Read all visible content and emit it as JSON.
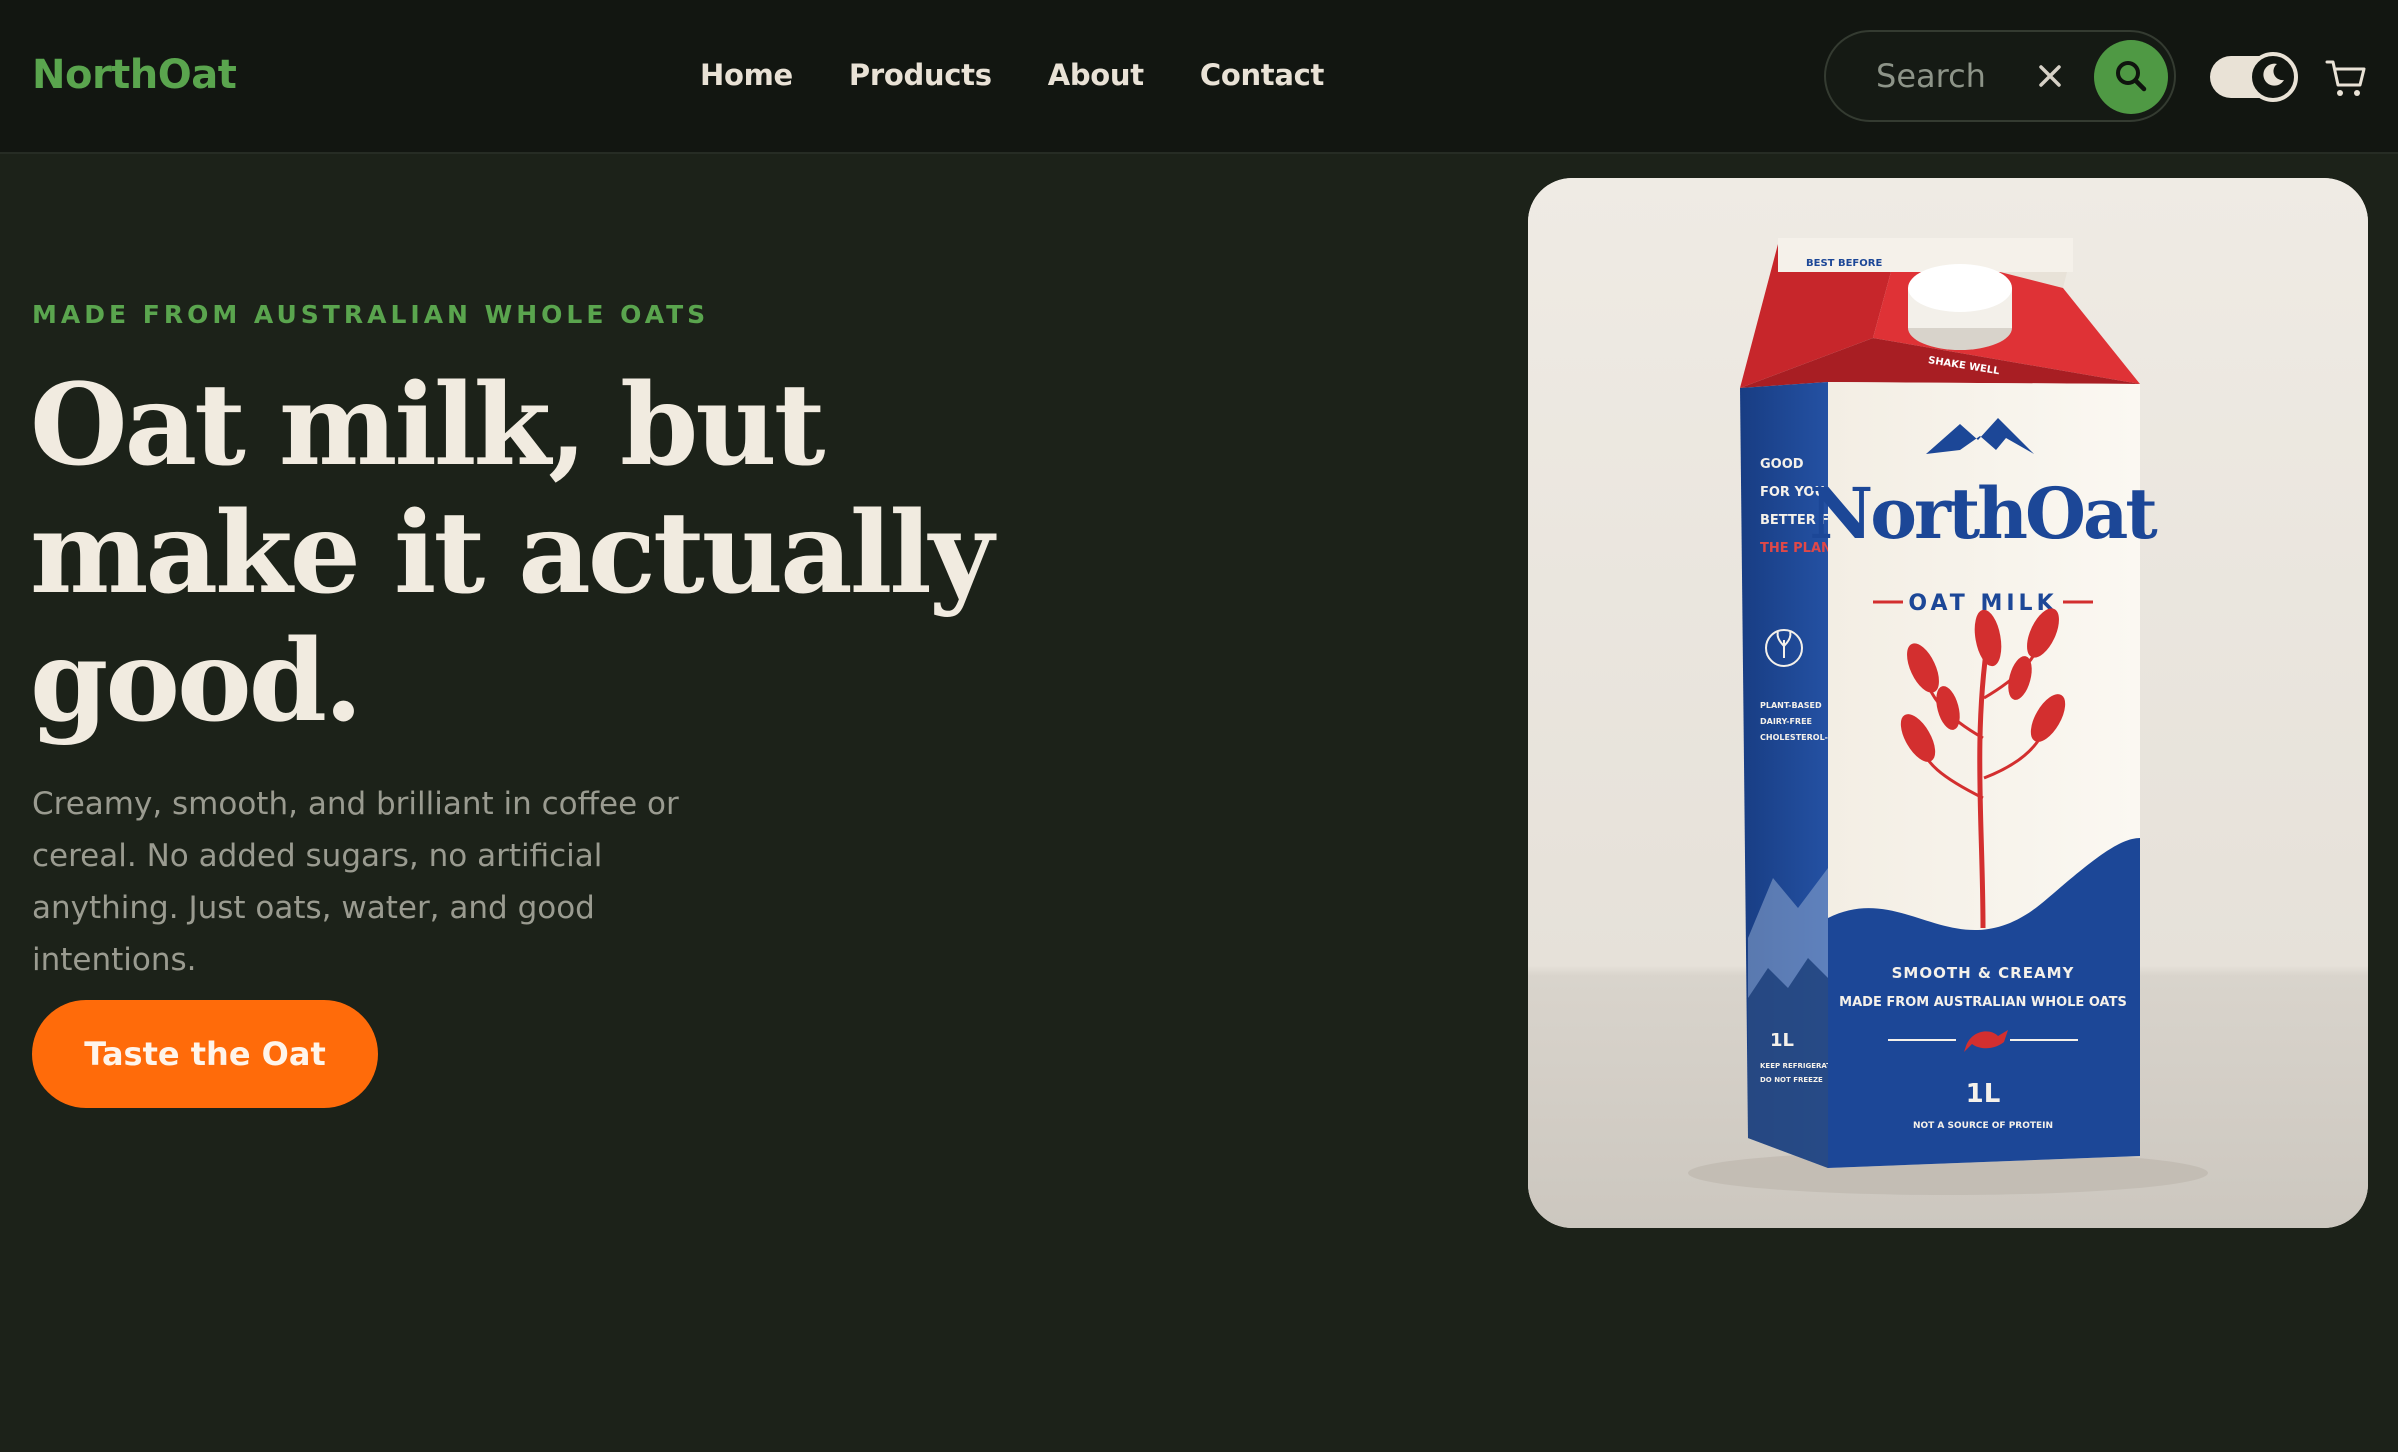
{
  "header": {
    "logo": "NorthOat",
    "nav": [
      "Home",
      "Products",
      "About",
      "Contact"
    ],
    "search": {
      "placeholder": "Search",
      "value": ""
    }
  },
  "hero": {
    "eyebrow": "MADE FROM AUSTRALIAN WHOLE OATS",
    "headline": "Oat milk, but make it actually good.",
    "subcopy": "Creamy, smooth, and brilliant in coffee or cereal. No added sugars, no artificial anything. Just oats, water, and good intentions.",
    "cta": "Taste the Oat"
  },
  "carton": {
    "top_label": "BEST BEFORE",
    "cap_label": "SHAKE WELL",
    "brand": "NorthOat",
    "product": "OAT MILK",
    "side_lines": [
      "GOOD",
      "FOR YOU.",
      "BETTER FOR",
      "THE PLANET."
    ],
    "side_claims": [
      "PLANT-BASED",
      "DAIRY-FREE",
      "CHOLESTEROL-FREE"
    ],
    "tagline": "SMOOTH & CREAMY",
    "origin": "MADE FROM AUSTRALIAN WHOLE OATS",
    "volume": "1L",
    "side_volume": "1L",
    "side_storage": [
      "KEEP REFRIGERATED",
      "DO NOT FREEZE"
    ],
    "footnote": "NOT A SOURCE OF PROTEIN"
  },
  "colors": {
    "background": "#1c2219",
    "header": "#121611",
    "accent_green": "#5aa54e",
    "cta_orange": "#ff6b0a",
    "carton_red": "#d32f2f",
    "carton_blue": "#1c4797"
  },
  "icons": [
    "clear-icon",
    "search-icon",
    "moon-icon",
    "cart-icon"
  ]
}
